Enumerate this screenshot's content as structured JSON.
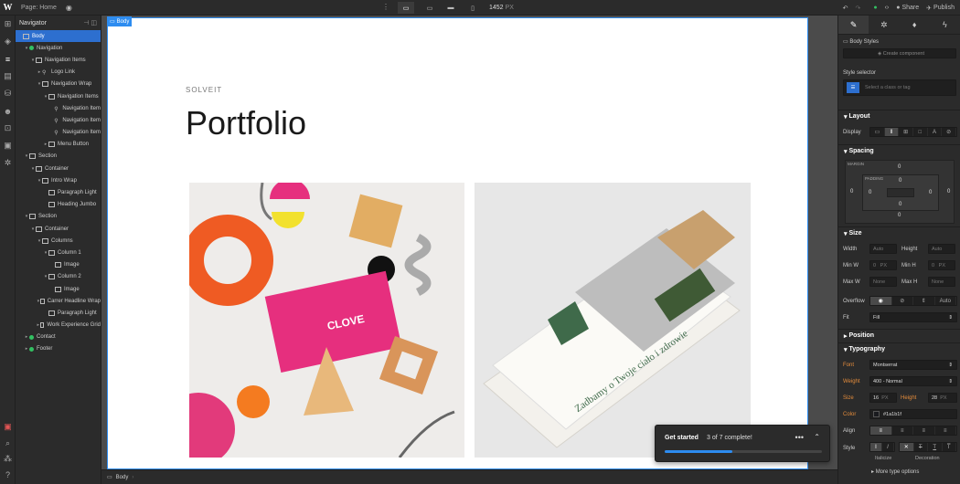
{
  "topbar": {
    "logo": "W",
    "page_label": "Page: Home",
    "px": "1452",
    "px_unit": "PX",
    "share": "Share",
    "publish": "Publish"
  },
  "leftrail": {
    "icons": [
      "add-icon",
      "box-icon",
      "layers-icon",
      "page-icon",
      "cms-icon",
      "users-icon",
      "ecommerce-icon",
      "assets-icon",
      "settings-icon"
    ]
  },
  "navigator": {
    "title": "Navigator",
    "items": [
      {
        "label": "Body",
        "depth": 0,
        "icon": "box",
        "selected": true,
        "toggle": ""
      },
      {
        "label": "Navigation",
        "depth": 1,
        "icon": "comp",
        "toggle": "▾"
      },
      {
        "label": "Navigation Items",
        "depth": 2,
        "icon": "box",
        "toggle": "▾"
      },
      {
        "label": "Logo Link",
        "depth": 3,
        "icon": "link",
        "toggle": "▸"
      },
      {
        "label": "Navigation Wrap",
        "depth": 3,
        "icon": "box",
        "toggle": "▾"
      },
      {
        "label": "Navigation Items",
        "depth": 4,
        "icon": "box",
        "toggle": "▾"
      },
      {
        "label": "Navigation Item",
        "depth": 5,
        "icon": "link",
        "toggle": ""
      },
      {
        "label": "Navigation Item",
        "depth": 5,
        "icon": "link",
        "toggle": ""
      },
      {
        "label": "Navigation Item",
        "depth": 5,
        "icon": "link",
        "toggle": ""
      },
      {
        "label": "Menu Button",
        "depth": 4,
        "icon": "box",
        "toggle": "▸"
      },
      {
        "label": "Section",
        "depth": 1,
        "icon": "box",
        "toggle": "▾"
      },
      {
        "label": "Container",
        "depth": 2,
        "icon": "box",
        "toggle": "▾"
      },
      {
        "label": "Intro Wrap",
        "depth": 3,
        "icon": "box",
        "toggle": "▾"
      },
      {
        "label": "Paragraph Light",
        "depth": 4,
        "icon": "box",
        "toggle": ""
      },
      {
        "label": "Heading Jumbo",
        "depth": 4,
        "icon": "box",
        "toggle": ""
      },
      {
        "label": "Section",
        "depth": 1,
        "icon": "box",
        "toggle": "▾"
      },
      {
        "label": "Container",
        "depth": 2,
        "icon": "box",
        "toggle": "▾"
      },
      {
        "label": "Columns",
        "depth": 3,
        "icon": "box",
        "toggle": "▾"
      },
      {
        "label": "Column 1",
        "depth": 4,
        "icon": "box",
        "toggle": "▾"
      },
      {
        "label": "Image",
        "depth": 5,
        "icon": "box",
        "toggle": ""
      },
      {
        "label": "Column 2",
        "depth": 4,
        "icon": "box",
        "toggle": "▾"
      },
      {
        "label": "Image",
        "depth": 5,
        "icon": "box",
        "toggle": ""
      },
      {
        "label": "Carrer Headline Wrap",
        "depth": 3,
        "icon": "box",
        "toggle": "▾"
      },
      {
        "label": "Paragraph Light",
        "depth": 4,
        "icon": "box",
        "toggle": ""
      },
      {
        "label": "Work Experience Grid",
        "depth": 3,
        "icon": "box",
        "toggle": "▸"
      },
      {
        "label": "Contact",
        "depth": 1,
        "icon": "comp",
        "toggle": "▸"
      },
      {
        "label": "Footer",
        "depth": 1,
        "icon": "comp",
        "toggle": "▸"
      }
    ]
  },
  "canvas": {
    "body_tag": "Body",
    "subheading": "SOLVEIT",
    "heading": "Portfolio",
    "image1_brand": "CLOVE",
    "image2_text": "Zadbamy o Twoje ciało i zdrowie"
  },
  "bottombar": {
    "crumb": "Body"
  },
  "toast": {
    "title": "Get started",
    "progress_text": "3 of 7 complete!",
    "progress": 0.43
  },
  "right_panel": {
    "selector_label": "Body Styles",
    "create_component": "Create component",
    "style_selector": "Style selector",
    "selector_placeholder": "Select a class or tag",
    "layout": "Layout",
    "display": "Display",
    "spacing": "Spacing",
    "margin": "MARGIN",
    "padding": "PADDING",
    "m_top": "0",
    "m_left": "0",
    "m_right": "0",
    "m_bottom": "0",
    "p_top": "0",
    "p_left": "0",
    "p_right": "0",
    "p_bottom": "0",
    "size": "Size",
    "width": "Width",
    "height": "Height",
    "auto": "Auto",
    "min_w": "Min W",
    "min_h": "Min H",
    "zero": "0",
    "px": "PX",
    "max_w": "Max W",
    "max_h": "Max H",
    "none": "None",
    "overflow": "Overflow",
    "fit": "Fit",
    "fit_val": "Fill",
    "position": "Position",
    "typography": "Typography",
    "font": "Font",
    "font_val": "Montserrat",
    "weight": "Weight",
    "weight_val": "400 - Normal",
    "size_lbl": "Size",
    "size_val": "16",
    "height_lbl": "Height",
    "height_val": "28",
    "color": "Color",
    "color_val": "#1a1b1f",
    "align": "Align",
    "style": "Style",
    "italicize": "Italicize",
    "decoration": "Decoration",
    "more_type": "More type options"
  }
}
